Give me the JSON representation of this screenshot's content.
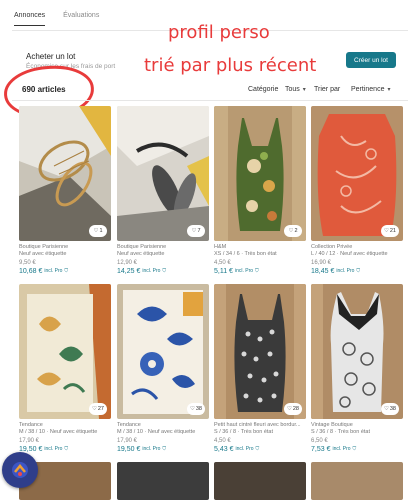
{
  "tabs": [
    {
      "label": "Annonces",
      "active": true
    },
    {
      "label": "Évaluations",
      "active": false
    }
  ],
  "lot": {
    "title": "Acheter un lot",
    "subtitle": "Économise sur les frais de port",
    "button": "Créer un lot"
  },
  "annotations": {
    "line1": "profil perso",
    "line2": "trié par plus récent"
  },
  "results": {
    "count": "690 articles",
    "category_label": "Catégorie",
    "category_value": "Tous",
    "sort_label": "Trier par",
    "sort_value": "Pertinence"
  },
  "products": [
    {
      "likes": "1",
      "brand": "Boutique Parisienne",
      "detail": "Neuf avec étiquette",
      "price": "9,50 €",
      "price_pro": "10,68 €",
      "pro_label": "incl. Pro"
    },
    {
      "likes": "7",
      "brand": "Boutique Parisienne",
      "detail": "Neuf avec étiquette",
      "price": "12,90 €",
      "price_pro": "14,25 €",
      "pro_label": "incl. Pro"
    },
    {
      "likes": "2",
      "brand": "H&M",
      "detail": "XS / 34 / 6 · Très bon état",
      "price": "4,50 €",
      "price_pro": "5,11 €",
      "pro_label": "incl. Pro"
    },
    {
      "likes": "21",
      "brand": "Collection Privée",
      "detail": "L / 40 / 12 · Neuf avec étiquette",
      "price": "16,90 €",
      "price_pro": "18,45 €",
      "pro_label": "incl. Pro"
    },
    {
      "likes": "27",
      "brand": "Tendance",
      "detail": "M / 38 / 10 · Neuf avec étiquette",
      "price": "17,90 €",
      "price_pro": "19,50 €",
      "pro_label": "incl. Pro"
    },
    {
      "likes": "38",
      "brand": "Tendance",
      "detail": "M / 38 / 10 · Neuf avec étiquette",
      "price": "17,90 €",
      "price_pro": "19,50 €",
      "pro_label": "incl. Pro"
    },
    {
      "likes": "28",
      "brand": "Petit haut cintré fleuri avec bordur...",
      "detail": "S / 36 / 8 · Très bon état",
      "price": "4,50 €",
      "price_pro": "5,43 €",
      "pro_label": "incl. Pro"
    },
    {
      "likes": "38",
      "brand": "Vintage Boutique",
      "detail": "S / 36 / 8 · Très bon état",
      "price": "6,50 €",
      "price_pro": "7,53 €",
      "pro_label": "incl. Pro"
    }
  ],
  "colors": {
    "accent": "#17788a",
    "annotation": "#e83b3b",
    "fab": "#2f3e8a"
  }
}
